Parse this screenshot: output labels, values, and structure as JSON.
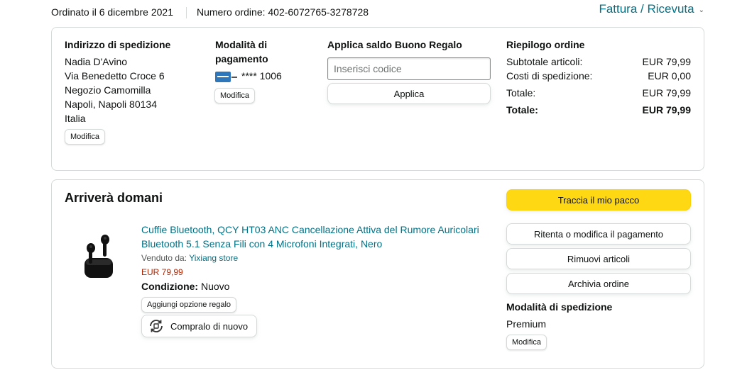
{
  "header": {
    "ordered_on": "Ordinato il 6 dicembre 2021",
    "order_number": "Numero ordine: 402-6072765-3278728",
    "invoice_link": "Fattura / Ricevuta"
  },
  "shipping_address": {
    "title": "Indirizzo di spedizione",
    "lines": [
      "Nadia D'Avino",
      "Via Benedetto Croce 6",
      "Negozio Camomilla",
      "Napoli, Napoli 80134",
      "Italia"
    ],
    "edit_label": "Modifica"
  },
  "payment": {
    "title_line1": "Modalità di",
    "title_line2": "pagamento",
    "card_icon": "amex-card-icon",
    "card_brand_color": "#2e77bb",
    "card_masked": "**** 1006",
    "edit_label": "Modifica"
  },
  "gift_card": {
    "title": "Applica saldo Buono Regalo",
    "input_placeholder": "Inserisci codice",
    "apply_label": "Applica"
  },
  "summary": {
    "title": "Riepilogo ordine",
    "rows": [
      {
        "label": "Subtotale articoli:",
        "value": "EUR 79,99"
      },
      {
        "label": "Costi di spedizione:",
        "value": "EUR 0,00"
      },
      {
        "label": "Totale:",
        "value": "EUR 79,99"
      },
      {
        "label": "Totale:",
        "value": "EUR 79,99"
      }
    ]
  },
  "shipment": {
    "status": "Arriverà domani",
    "product": {
      "title": "Cuffie Bluetooth, QCY HT03 ANC Cancellazione Attiva del Rumore Auricolari Bluetooth 5.1 Senza Fili con 4 Microfoni Integrati, Nero",
      "sold_by_label": "Venduto da:",
      "seller": "Yixiang store",
      "price": "EUR 79,99",
      "condition_label": "Condizione:",
      "condition_value": "Nuovo",
      "gift_option_label": "Aggiungi opzione regalo",
      "rebuy_label": "Compralo di nuovo"
    },
    "actions": {
      "track": "Traccia il mio pacco",
      "retry_payment": "Ritenta o modifica il pagamento",
      "remove_items": "Rimuovi articoli",
      "archive": "Archivia ordine"
    },
    "shipping_mode": {
      "title": "Modalità di spedizione",
      "value": "Premium",
      "edit_label": "Modifica"
    }
  },
  "colors": {
    "link": "#007185",
    "price": "#b12704",
    "primary_button": "#ffd814",
    "border": "#d5d9d9"
  }
}
